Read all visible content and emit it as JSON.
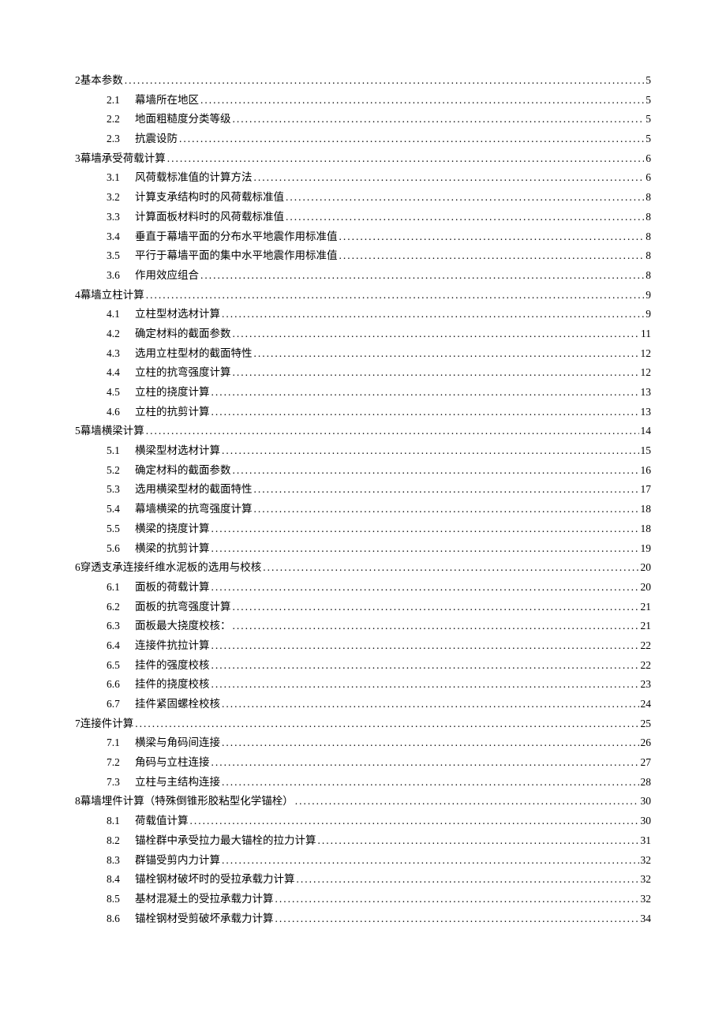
{
  "toc": [
    {
      "type": "section",
      "num": "2",
      "title": "基本参数",
      "page": "5"
    },
    {
      "type": "sub",
      "num": "2.1",
      "title": "幕墙所在地区",
      "page": "5"
    },
    {
      "type": "sub",
      "num": "2.2",
      "title": "地面粗糙度分类等级",
      "page": "5"
    },
    {
      "type": "sub",
      "num": "2.3",
      "title": "抗震设防",
      "page": "5"
    },
    {
      "type": "section",
      "num": "3",
      "title": "幕墙承受荷载计算",
      "page": "6"
    },
    {
      "type": "sub",
      "num": "3.1",
      "title": "风荷载标准值的计算方法",
      "page": "6"
    },
    {
      "type": "sub",
      "num": "3.2",
      "title": "计算支承结构时的风荷载标准值",
      "page": "8"
    },
    {
      "type": "sub",
      "num": "3.3",
      "title": "计算面板材料时的风荷载标准值",
      "page": "8"
    },
    {
      "type": "sub",
      "num": "3.4",
      "title": "垂直于幕墙平面的分布水平地震作用标准值",
      "page": "8"
    },
    {
      "type": "sub",
      "num": "3.5",
      "title": "平行于幕墙平面的集中水平地震作用标准值",
      "page": "8"
    },
    {
      "type": "sub",
      "num": "3.6",
      "title": "作用效应组合",
      "page": "8"
    },
    {
      "type": "section",
      "num": "4",
      "title": "幕墙立柱计算",
      "page": "9"
    },
    {
      "type": "sub",
      "num": "4.1",
      "title": "立柱型材选材计算",
      "page": "9"
    },
    {
      "type": "sub",
      "num": "4.2",
      "title": "确定材料的截面参数",
      "page": "11"
    },
    {
      "type": "sub",
      "num": "4.3",
      "title": "选用立柱型材的截面特性",
      "page": "12"
    },
    {
      "type": "sub",
      "num": "4.4",
      "title": "立柱的抗弯强度计算",
      "page": "12"
    },
    {
      "type": "sub",
      "num": "4.5",
      "title": "立柱的挠度计算",
      "page": "13"
    },
    {
      "type": "sub",
      "num": "4.6",
      "title": "立柱的抗剪计算",
      "page": "13"
    },
    {
      "type": "section",
      "num": "5",
      "title": "幕墙横梁计算",
      "page": "14"
    },
    {
      "type": "sub",
      "num": "5.1",
      "title": "横梁型材选材计算",
      "page": "15"
    },
    {
      "type": "sub",
      "num": "5.2",
      "title": "确定材料的截面参数",
      "page": "16"
    },
    {
      "type": "sub",
      "num": "5.3",
      "title": "选用横梁型材的截面特性",
      "page": "17"
    },
    {
      "type": "sub",
      "num": "5.4",
      "title": "幕墙横梁的抗弯强度计算",
      "page": "18"
    },
    {
      "type": "sub",
      "num": "5.5",
      "title": "横梁的挠度计算",
      "page": "18"
    },
    {
      "type": "sub",
      "num": "5.6",
      "title": "横梁的抗剪计算",
      "page": "19"
    },
    {
      "type": "section",
      "num": "6",
      "title": "穿透支承连接纤维水泥板的选用与校核",
      "page": "20"
    },
    {
      "type": "sub",
      "num": "6.1",
      "title": "面板的荷载计算",
      "page": "20"
    },
    {
      "type": "sub",
      "num": "6.2",
      "title": "面板的抗弯强度计算",
      "page": "21"
    },
    {
      "type": "sub",
      "num": "6.3",
      "title": "面板最大挠度校核：",
      "page": "21"
    },
    {
      "type": "sub",
      "num": "6.4",
      "title": "连接件抗拉计算",
      "page": "22"
    },
    {
      "type": "sub",
      "num": "6.5",
      "title": "挂件的强度校核",
      "page": "22"
    },
    {
      "type": "sub",
      "num": "6.6",
      "title": "挂件的挠度校核",
      "page": "23"
    },
    {
      "type": "sub",
      "num": "6.7",
      "title": "挂件紧固螺栓校核",
      "page": "24"
    },
    {
      "type": "section",
      "num": "7",
      "title": "连接件计算",
      "page": "25"
    },
    {
      "type": "sub",
      "num": "7.1",
      "title": "横梁与角码间连接",
      "page": "26"
    },
    {
      "type": "sub",
      "num": "7.2",
      "title": "角码与立柱连接",
      "page": "27"
    },
    {
      "type": "sub",
      "num": "7.3",
      "title": "立柱与主结构连接",
      "page": "28"
    },
    {
      "type": "section",
      "num": "8",
      "title": "幕墙埋件计算（特殊倒锥形胶粘型化学锚栓）",
      "page": "30"
    },
    {
      "type": "sub",
      "num": "8.1",
      "title": "荷载值计算",
      "page": "30"
    },
    {
      "type": "sub",
      "num": "8.2",
      "title": "锚栓群中承受拉力最大锚栓的拉力计算",
      "page": "31"
    },
    {
      "type": "sub",
      "num": "8.3",
      "title": "群锚受剪内力计算",
      "page": "32"
    },
    {
      "type": "sub",
      "num": "8.4",
      "title": "锚栓钢材破坏时的受拉承载力计算",
      "page": "32"
    },
    {
      "type": "sub",
      "num": "8.5",
      "title": "基材混凝土的受拉承载力计算",
      "page": "32"
    },
    {
      "type": "sub",
      "num": "8.6",
      "title": "锚栓钢材受剪破坏承载力计算",
      "page": "34"
    }
  ]
}
